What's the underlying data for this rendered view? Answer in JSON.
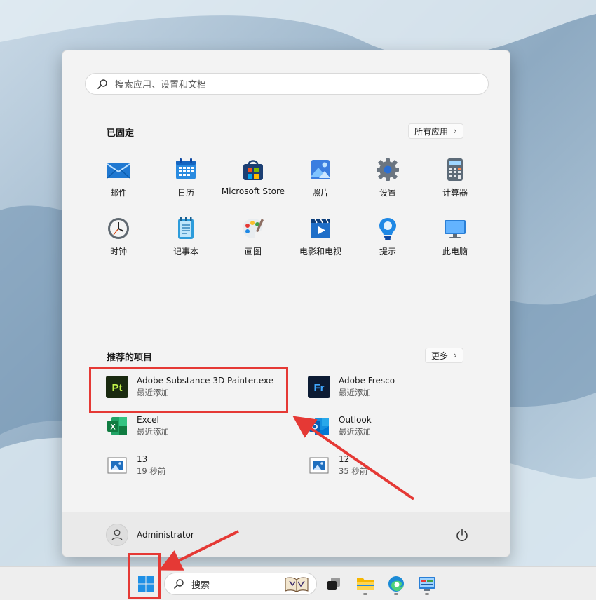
{
  "start_menu": {
    "search_placeholder": "搜索应用、设置和文档",
    "pinned_title": "已固定",
    "all_apps_label": "所有应用",
    "pinned_apps": [
      {
        "label": "邮件",
        "icon": "mail-icon"
      },
      {
        "label": "日历",
        "icon": "calendar-icon"
      },
      {
        "label": "Microsoft Store",
        "icon": "store-icon"
      },
      {
        "label": "照片",
        "icon": "photos-icon"
      },
      {
        "label": "设置",
        "icon": "settings-gear-icon"
      },
      {
        "label": "计算器",
        "icon": "calculator-icon"
      },
      {
        "label": "时钟",
        "icon": "clock-icon"
      },
      {
        "label": "记事本",
        "icon": "notepad-icon"
      },
      {
        "label": "画图",
        "icon": "paint-icon"
      },
      {
        "label": "电影和电视",
        "icon": "movies-tv-icon"
      },
      {
        "label": "提示",
        "icon": "tips-icon"
      },
      {
        "label": "此电脑",
        "icon": "this-pc-icon"
      }
    ],
    "recommended_title": "推荐的项目",
    "more_label": "更多",
    "recommended": [
      {
        "name": "Adobe Substance 3D Painter.exe",
        "sub": "最近添加",
        "icon": "substance-painter-icon"
      },
      {
        "name": "Adobe Fresco",
        "sub": "最近添加",
        "icon": "adobe-fresco-icon"
      },
      {
        "name": "Excel",
        "sub": "最近添加",
        "icon": "excel-icon"
      },
      {
        "name": "Outlook",
        "sub": "最近添加",
        "icon": "outlook-icon"
      },
      {
        "name": "13",
        "sub": "19 秒前",
        "icon": "image-file-icon"
      },
      {
        "name": "12",
        "sub": "35 秒前",
        "icon": "image-file-icon"
      }
    ],
    "user_name": "Administrator",
    "pt_badge": "Pt",
    "fr_badge": "Fr",
    "x_badge": "X",
    "o_badge": "O"
  },
  "taskbar": {
    "search_label": "搜索"
  },
  "colors": {
    "highlight": "#e53935",
    "accent": "#0067c0"
  }
}
